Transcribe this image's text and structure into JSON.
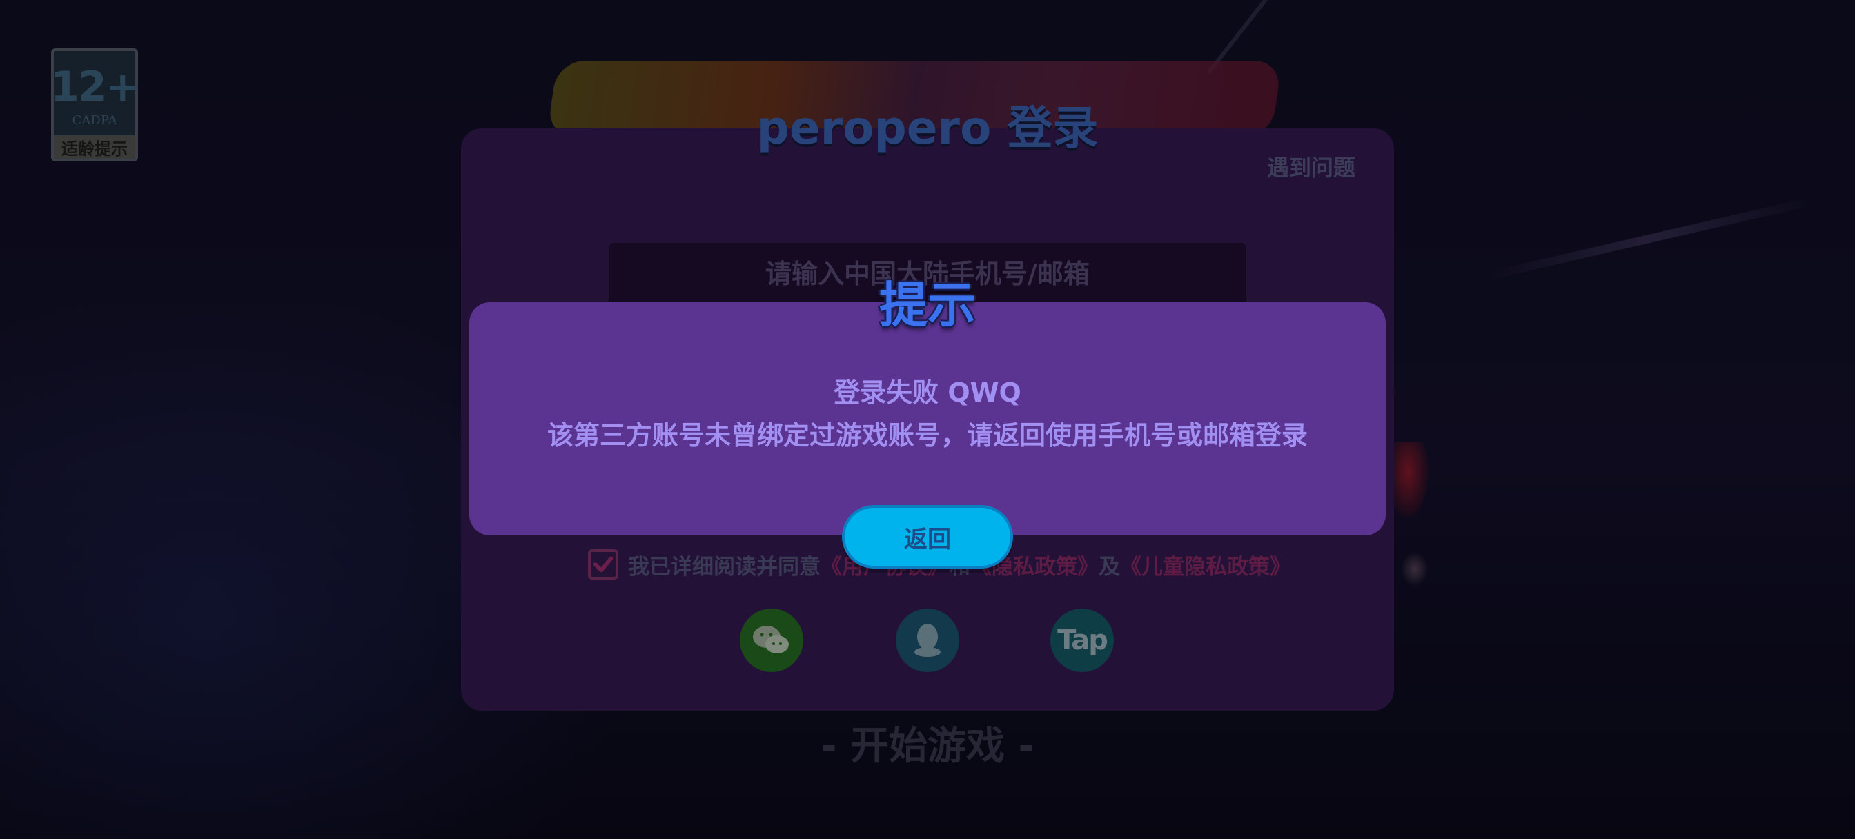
{
  "age_badge": {
    "rating": "12+",
    "org": "CADPA",
    "label": "适龄提示"
  },
  "login": {
    "title": "peropero 登录",
    "help_label": "遇到问题",
    "account_placeholder": "请输入中国大陆手机号/邮箱",
    "agreement": {
      "prefix": "我已详细阅读并同意",
      "user_agreement": "《用户协议》",
      "and1": "和",
      "privacy_policy": "《隐私政策》",
      "and2": "及",
      "children_privacy": "《儿童隐私政策》",
      "checked": true
    },
    "social": {
      "wechat_icon": "wechat-icon",
      "qq_icon": "qq-icon",
      "tap_label": "Tap"
    },
    "start_label": "- 开始游戏 -"
  },
  "dialog": {
    "title": "提示",
    "line1": "登录失败 QWQ",
    "line2": "该第三方账号未曾绑定过游戏账号，请返回使用手机号或邮箱登录",
    "back_label": "返回"
  },
  "colors": {
    "accent": "#00b3ec",
    "dialog_bg": "#5b3492",
    "panel_bg": "#231138",
    "title_blue": "#3a72ef"
  }
}
